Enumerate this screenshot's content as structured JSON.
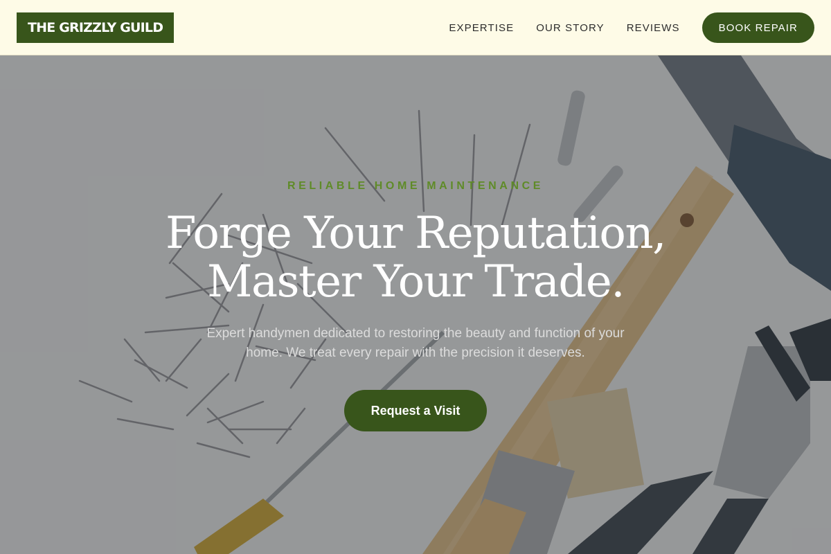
{
  "header": {
    "logo": "THE GRIZZLY GUILD",
    "nav": [
      {
        "label": "EXPERTISE"
      },
      {
        "label": "OUR STORY"
      },
      {
        "label": "REVIEWS"
      }
    ],
    "cta_label": "BOOK REPAIR"
  },
  "hero": {
    "eyebrow": "RELIABLE HOME MAINTENANCE",
    "headline_line1": "Forge Your Reputation,",
    "headline_line2": "Master Your Trade.",
    "subtext": "Expert handymen dedicated to restoring the beauty and function of your home. We treat every repair with the precision it deserves.",
    "cta_label": "Request a Visit",
    "background_image": "workbench-tools-photo"
  },
  "colors": {
    "brand_green": "#38551b",
    "accent_green": "#5f8b28",
    "header_bg": "#fefbe7"
  }
}
